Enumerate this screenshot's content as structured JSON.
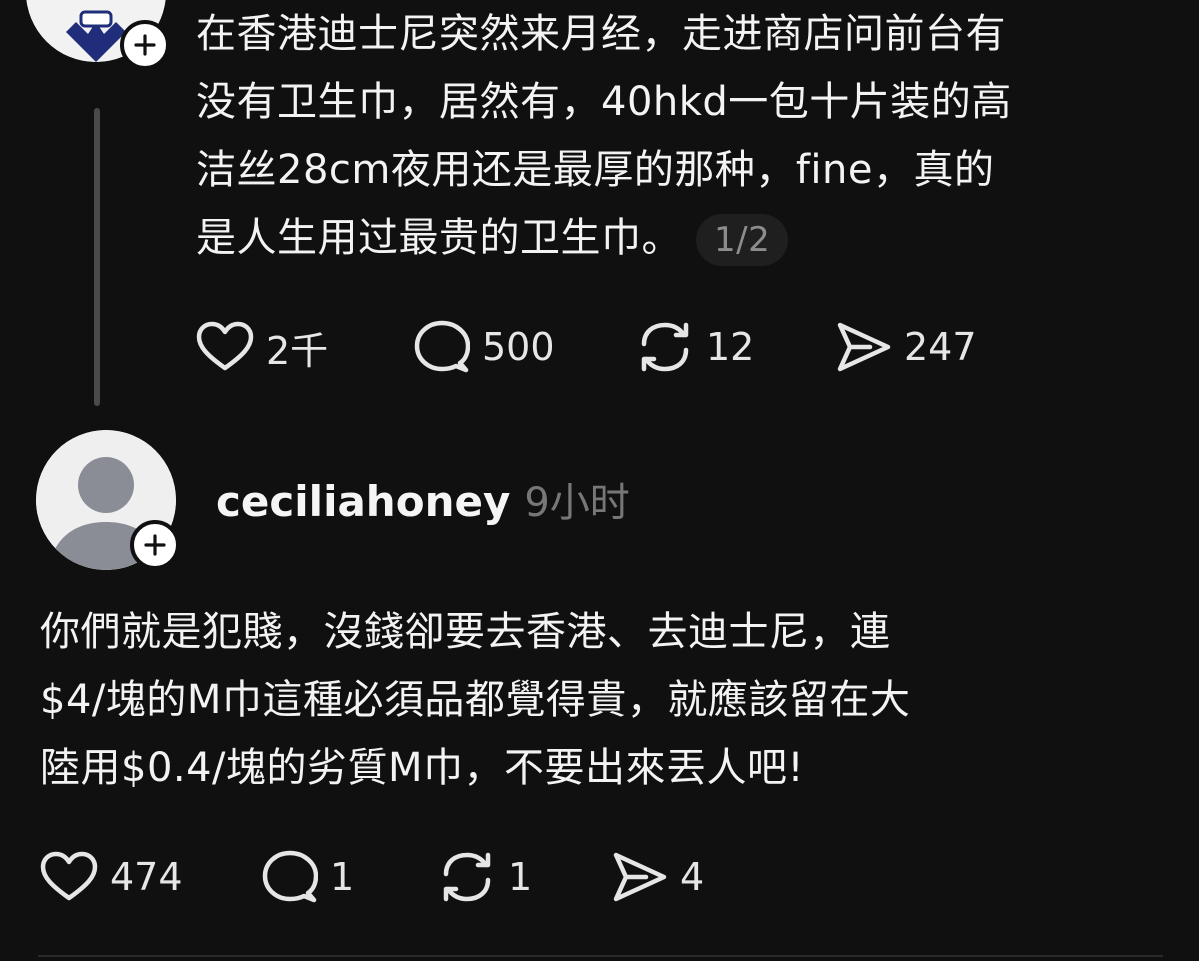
{
  "colors": {
    "background": "#101010",
    "text": "#f3f3f3",
    "muted": "#777777",
    "divider": "#2a2a2a"
  },
  "post1": {
    "avatar_icon": "cartoon-avatar-icon",
    "lines": [
      "在香港迪士尼突然来月经，走进商店问前台有",
      "没有卫生巾，居然有，40hkd一包十片装的高",
      "洁丝28cm夜用还是最厚的那种，fine，真的",
      "是人生用过最贵的卫生巾。"
    ],
    "page_indicator": "1/2",
    "likes": "2千",
    "comments": "500",
    "reposts": "12",
    "shares": "247"
  },
  "post2": {
    "username": "ceciliahoney",
    "time": "9小时",
    "avatar_icon": "default-user-icon",
    "lines": [
      "你們就是犯賤，沒錢卻要去香港、去迪士尼，連",
      "$4/塊的M巾這種必須品都覺得貴，就應該留在大",
      "陸用$0.4/塊的劣質M巾，不要出來丟人吧!"
    ],
    "likes": "474",
    "comments": "1",
    "reposts": "1",
    "shares": "4"
  }
}
